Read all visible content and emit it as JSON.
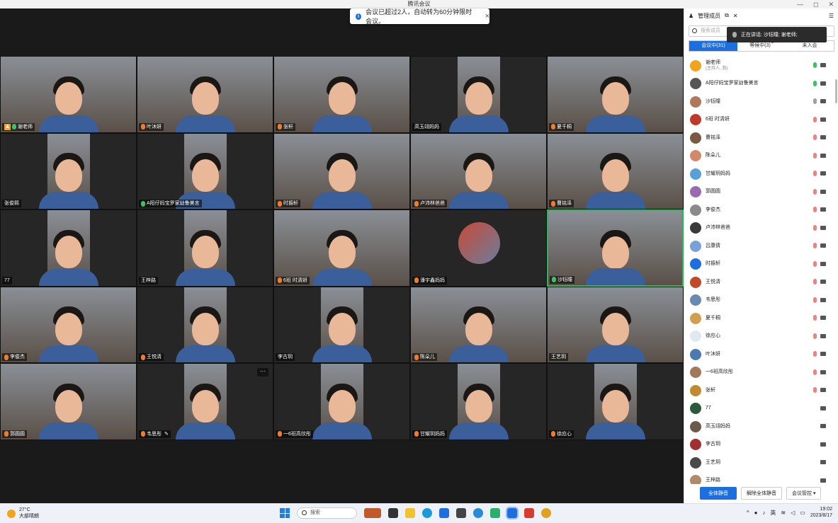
{
  "window": {
    "title": "腾讯会议",
    "controls": [
      "—",
      "◻",
      "✕"
    ]
  },
  "notice": {
    "text": "会议已超过2人，自动转为60分钟限时会议。",
    "close": "×"
  },
  "tiles": [
    {
      "name": "谢老师",
      "host": true,
      "mic": "green"
    },
    {
      "name": "叶沐妍",
      "mic": "orange"
    },
    {
      "name": "张轩",
      "mic": "orange"
    },
    {
      "name": "高玉翊妈妈",
      "mic": "none"
    },
    {
      "name": "夏千桐",
      "mic": "orange"
    },
    {
      "name": "张俊熙",
      "mic": "none"
    },
    {
      "name": "A阳仔妈宝罗家幼鲁美言",
      "mic": "green"
    },
    {
      "name": "时振轩",
      "mic": "orange"
    },
    {
      "name": "卢沛林爸爸",
      "mic": "orange"
    },
    {
      "name": "曹铭泽",
      "mic": "orange"
    },
    {
      "name": "77",
      "mic": "none"
    },
    {
      "name": "王梓路",
      "mic": "none"
    },
    {
      "name": "6班 时清妍",
      "mic": "orange"
    },
    {
      "name": "潘宇鑫妈妈",
      "mic": "orange"
    },
    {
      "name": "沙钰曈",
      "mic": "green",
      "active": true
    },
    {
      "name": "李俊杰",
      "mic": "orange"
    },
    {
      "name": "王悦清",
      "mic": "orange"
    },
    {
      "name": "李古玥",
      "mic": "none"
    },
    {
      "name": "陈朵儿",
      "mic": "orange"
    },
    {
      "name": "王艺玥",
      "mic": "none"
    },
    {
      "name": "郭圆圆",
      "mic": "orange"
    },
    {
      "name": "韦思彤",
      "mic": "orange",
      "pencil": true,
      "more": true
    },
    {
      "name": "一6班高欣彤",
      "mic": "orange"
    },
    {
      "name": "甘耀玥妈妈",
      "mic": "orange"
    },
    {
      "name": "徐应心",
      "mic": "orange"
    }
  ],
  "panel": {
    "title": "管理成员",
    "search_placeholder": "搜索成员",
    "speaking": "正在讲话: 沙钰曈; 谢老师;",
    "tabs": [
      "会议中(31)",
      "等候中(3)",
      "未入会"
    ],
    "members": [
      {
        "name": "谢老师",
        "sub": "(主持人, 我)",
        "color": "#f2a41c",
        "mic": "green"
      },
      {
        "name": "A阳仔妈宝罗家幼鲁美言",
        "color": "#555555",
        "mic": "green"
      },
      {
        "name": "沙钰曈",
        "color": "#b07a5a",
        "mic": "gray"
      },
      {
        "name": "6班 时清妍",
        "color": "#c0392b",
        "mic": "red"
      },
      {
        "name": "曹铭泽",
        "color": "#7a5a44",
        "mic": "red"
      },
      {
        "name": "陈朵儿",
        "color": "#d08a6a",
        "mic": "red"
      },
      {
        "name": "甘耀玥妈妈",
        "color": "#5aa0d8",
        "mic": "red"
      },
      {
        "name": "郭圆圆",
        "color": "#9a6ab0",
        "mic": "red"
      },
      {
        "name": "李俊杰",
        "color": "#8a8a8a",
        "mic": "red"
      },
      {
        "name": "卢沛林爸爸",
        "color": "#3a3a3a",
        "mic": "red"
      },
      {
        "name": "吕康倩",
        "color": "#7aa0d8",
        "mic": "red"
      },
      {
        "name": "时振轩",
        "color": "#1d6fe0",
        "mic": "red"
      },
      {
        "name": "王悦清",
        "color": "#c04a2a",
        "mic": "red"
      },
      {
        "name": "韦思彤",
        "color": "#6a8ab0",
        "mic": "red"
      },
      {
        "name": "夏千桐",
        "color": "#d0a050",
        "mic": "red"
      },
      {
        "name": "徐应心",
        "color": "#e0e8f0",
        "mic": "red"
      },
      {
        "name": "叶沐妍",
        "color": "#4a7ab0",
        "mic": "red"
      },
      {
        "name": "一6班高欣彤",
        "color": "#a07a5a",
        "mic": "red"
      },
      {
        "name": "张轩",
        "color": "#c08a30",
        "mic": "red"
      },
      {
        "name": "77",
        "color": "#2a5a3a",
        "mic": "none"
      },
      {
        "name": "高玉翊妈妈",
        "color": "#6a5a4a",
        "mic": "none"
      },
      {
        "name": "李古玥",
        "color": "#a03030",
        "mic": "none"
      },
      {
        "name": "王艺玥",
        "color": "#4a4a4a",
        "mic": "none"
      },
      {
        "name": "王梓路",
        "color": "#b08a6a",
        "mic": "none"
      }
    ],
    "footer": {
      "mute_all": "全体静音",
      "unmute_all": "解除全体静音",
      "control": "会议管控 ▾"
    }
  },
  "taskbar": {
    "temp": "27°C",
    "weather": "大部晴朗",
    "search": "搜索",
    "lang": "英",
    "time": "19:02",
    "date": "2023/8/17"
  }
}
